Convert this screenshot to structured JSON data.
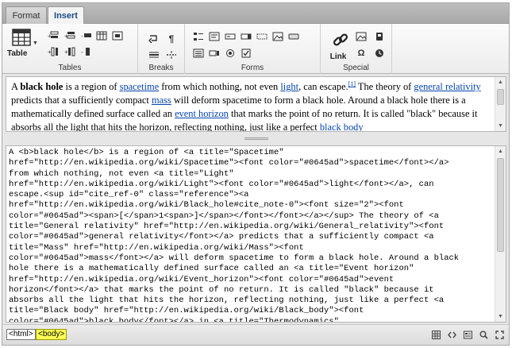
{
  "tabs": [
    {
      "label": "Format",
      "active": false
    },
    {
      "label": "Insert",
      "active": true
    }
  ],
  "ribbon": {
    "groups": {
      "tables": "Tables",
      "breaks": "Breaks",
      "forms": "Forms",
      "special": "Special"
    },
    "table_button": "Table",
    "link_button": "Link"
  },
  "wysiwyg": {
    "p1": "A ",
    "b1": "black hole",
    "p2": " is a region of ",
    "a_spacetime": "spacetime",
    "p3": " from which nothing, not even ",
    "a_light": "light",
    "p4": ", can escape.",
    "sup": "[1]",
    "p5": " The theory of ",
    "a_gr": "general relativity",
    "p6": " predicts that a sufficiently compact ",
    "a_mass": "mass",
    "p7": " will deform spacetime to form a black hole. Around a black hole there is a mathematically defined surface called an ",
    "a_eh": "event horizon",
    "p8": " that marks the point of no return. It is called \"black\" because it absorbs all the light that hits the horizon, reflecting nothing, just like a perfect ",
    "a_bb": "black body"
  },
  "source_lines": [
    "A <b>black hole</b> is a region of <a title=\"Spacetime\"",
    "href=\"http://en.wikipedia.org/wiki/Spacetime\"><font color=\"#0645ad\">spacetime</font></a>",
    "from which nothing, not even <a title=\"Light\"",
    "href=\"http://en.wikipedia.org/wiki/Light\"><font color=\"#0645ad\">light</font></a>, can",
    "escape.<sup id=\"cite_ref-0\" class=\"reference\"><a",
    "href=\"http://en.wikipedia.org/wiki/Black_hole#cite_note-0\"><font size=\"2\"><font",
    "color=\"#0645ad\"><span>[</span>1<span>]</span></font></font></a></sup> The theory of <a",
    "title=\"General relativity\" href=\"http://en.wikipedia.org/wiki/General_relativity\"><font",
    "color=\"#0645ad\">general relativity</font></a> predicts that a sufficiently compact <a",
    "title=\"Mass\" href=\"http://en.wikipedia.org/wiki/Mass\"><font",
    "color=\"#0645ad\">mass</font></a> will deform spacetime to form a black hole. Around a black",
    "hole there is a mathematically defined surface called an <a title=\"Event horizon\"",
    "href=\"http://en.wikipedia.org/wiki/Event_horizon\"><font color=\"#0645ad\">event",
    "horizon</font></a> that marks the point of no return. It is called \"black\" because it",
    "absorbs all the light that hits the horizon, reflecting nothing, just like a perfect <a",
    "title=\"Black body\" href=\"http://en.wikipedia.org/wiki/Black_body\"><font",
    "color=\"#0645ad\">black body</font></a> in <a title=\"Thermodynamics\""
  ],
  "statusbar": {
    "crumbs": [
      "<html>",
      "<body>"
    ]
  },
  "colors": {
    "link": "#0645ad",
    "crumb_active": "#ffff55"
  }
}
